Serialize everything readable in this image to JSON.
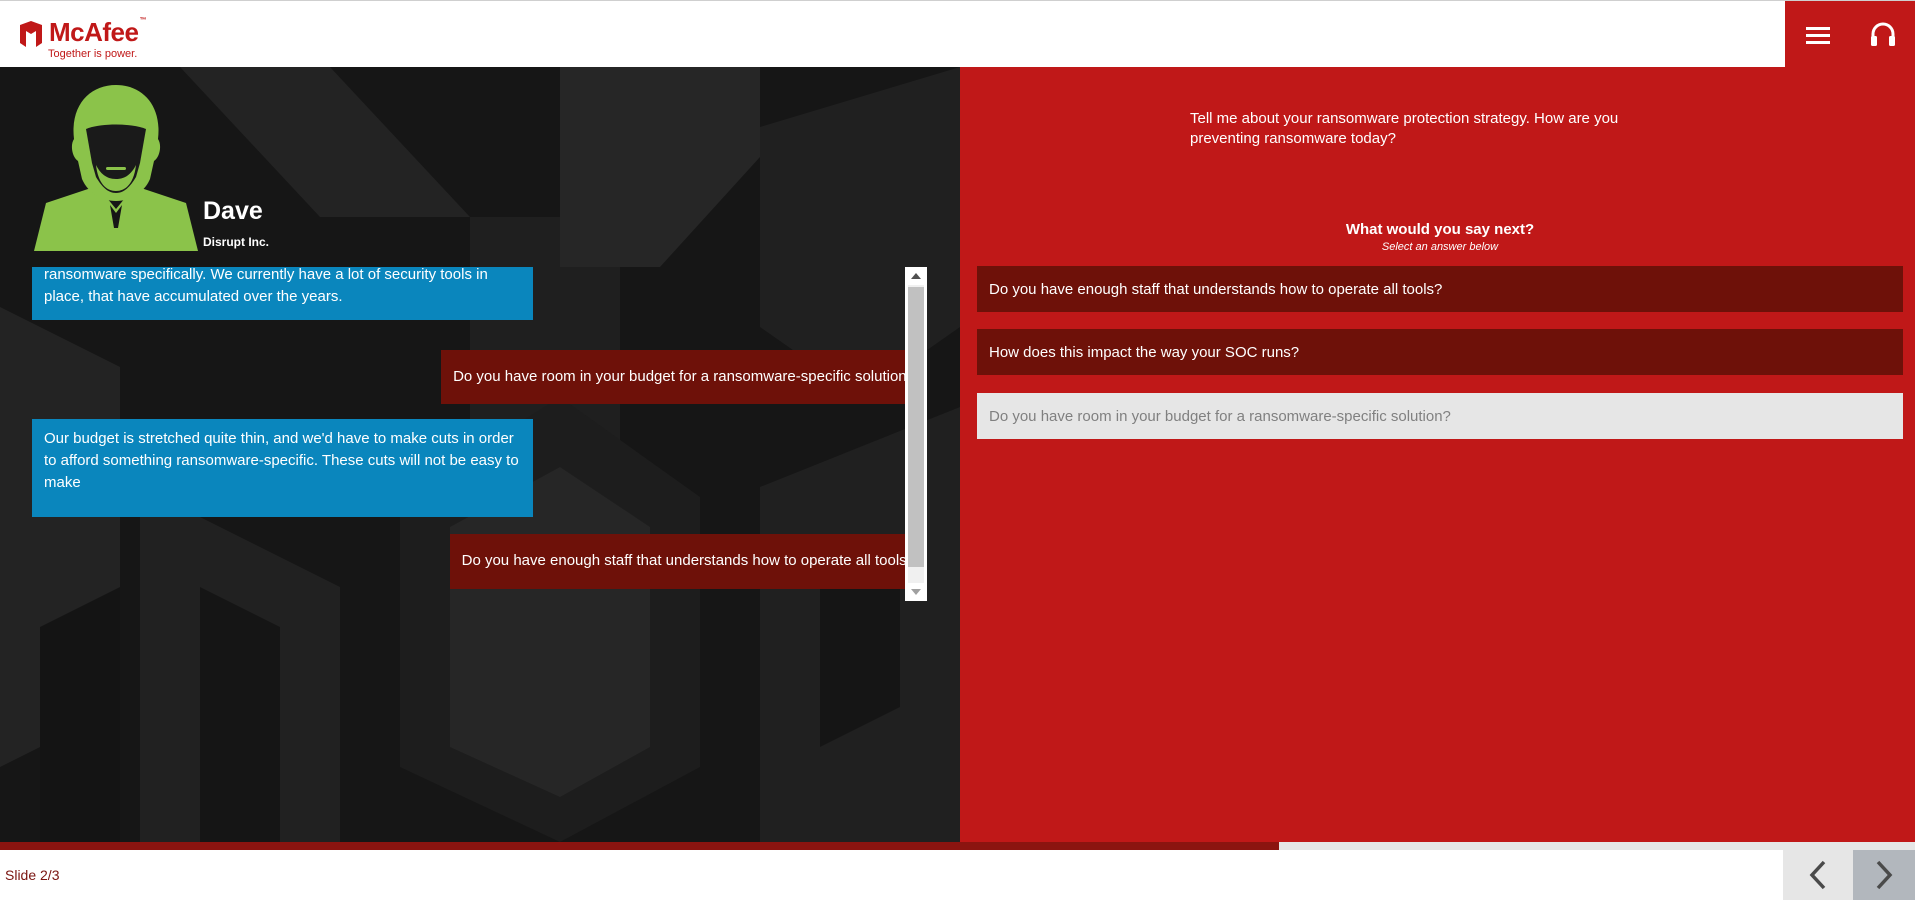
{
  "header": {
    "logo_text": "McAfee",
    "logo_tm": "™",
    "tagline": "Together is power.",
    "brand_color": "#c01818"
  },
  "character": {
    "name": "Dave",
    "company": "Disrupt Inc.",
    "avatar_color": "#8bc34a"
  },
  "chat": {
    "messages": [
      {
        "from": "them",
        "text": "ransomware specifically. We currently have a lot of security tools in place, that have accumulated over the years."
      },
      {
        "from": "me",
        "text": "Do you have room in your budget for a ransomware-specific solution?"
      },
      {
        "from": "them",
        "text": "Our budget is stretched quite thin, and we'd have to make cuts in order to afford something ransomware-specific. These cuts will not be easy to make"
      },
      {
        "from": "me",
        "text": "Do you have enough staff that understands how to operate all tools?"
      }
    ]
  },
  "question": {
    "prompt": "Tell me about your ransomware protection strategy. How are you preventing ransomware today?",
    "next_title": "What would you say next?",
    "next_subtitle": "Select an answer below",
    "options": [
      {
        "label": "Do you have enough staff that understands how to operate all tools?",
        "state": "available"
      },
      {
        "label": "How does this impact the way your SOC runs?",
        "state": "available"
      },
      {
        "label": "Do you have room in your budget for a ransomware-specific solution?",
        "state": "used"
      }
    ]
  },
  "footer": {
    "slide_label": "Slide 2/3",
    "progress_fraction": 0.668
  },
  "icons": {
    "menu": "hamburger-menu-icon",
    "audio": "headphones-icon",
    "prev": "chevron-left-icon",
    "next": "chevron-right-icon"
  }
}
